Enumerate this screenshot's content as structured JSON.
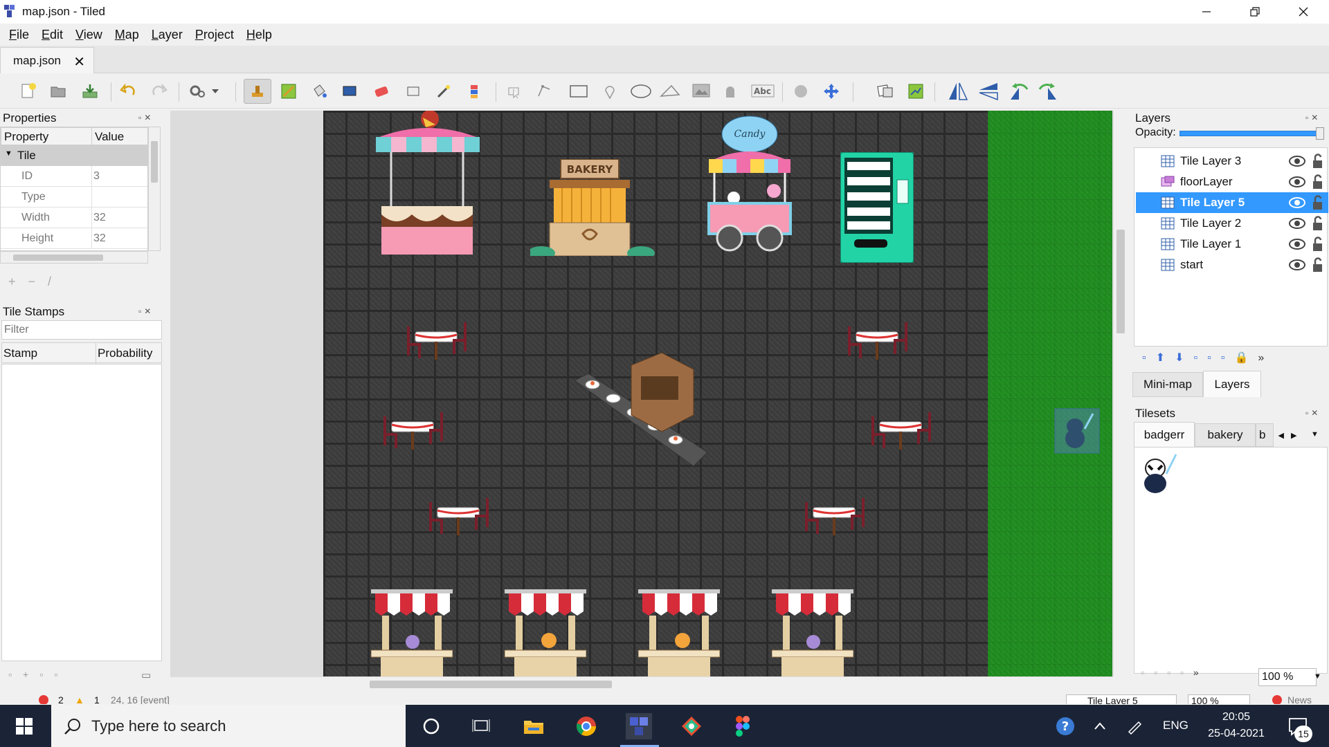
{
  "window": {
    "title": "map.json - Tiled"
  },
  "menu": [
    "File",
    "Edit",
    "View",
    "Map",
    "Layer",
    "Project",
    "Help"
  ],
  "document_tab": {
    "label": "map.json",
    "close": "✕"
  },
  "properties": {
    "title": "Properties",
    "col_property": "Property",
    "col_value": "Value",
    "group": "Tile",
    "rows": [
      {
        "key": "ID",
        "value": "3"
      },
      {
        "key": "Type",
        "value": ""
      },
      {
        "key": "Width",
        "value": "32"
      },
      {
        "key": "Height",
        "value": "32"
      }
    ]
  },
  "tile_stamps": {
    "title": "Tile Stamps",
    "filter_placeholder": "Filter",
    "col_stamp": "Stamp",
    "col_probability": "Probability"
  },
  "map_sprites": {
    "bakery_sign": "BAKERY",
    "candy_sign": "Candy"
  },
  "layers": {
    "title": "Layers",
    "opacity_label": "Opacity:",
    "opacity": 1.0,
    "items": [
      {
        "name": "Tile Layer 3",
        "type": "tile",
        "selected": false
      },
      {
        "name": "floorLayer",
        "type": "object",
        "selected": false
      },
      {
        "name": "Tile Layer 5",
        "type": "tile",
        "selected": true
      },
      {
        "name": "Tile Layer 2",
        "type": "tile",
        "selected": false
      },
      {
        "name": "Tile Layer 1",
        "type": "tile",
        "selected": false
      },
      {
        "name": "start",
        "type": "tile",
        "selected": false
      }
    ]
  },
  "dock_tabs": {
    "minimap": "Mini-map",
    "layers": "Layers"
  },
  "tilesets": {
    "title": "Tilesets",
    "tabs": [
      "badgerr",
      "bakery",
      "b"
    ],
    "zoom": "100 %"
  },
  "status": {
    "errors": "2",
    "warnings": "1",
    "coords": "24, 16 [event]",
    "layer": "Tile Layer 5",
    "zoom": "100 %",
    "news": "News"
  },
  "taskbar": {
    "search_placeholder": "Type here to search",
    "language": "ENG",
    "time": "20:05",
    "date": "25-04-2021",
    "notifications": "15"
  },
  "colors": {
    "selection": "#3399ff",
    "taskbar": "#1b2436",
    "grass": "#1e8a1e",
    "floor": "#3b3b3b"
  }
}
